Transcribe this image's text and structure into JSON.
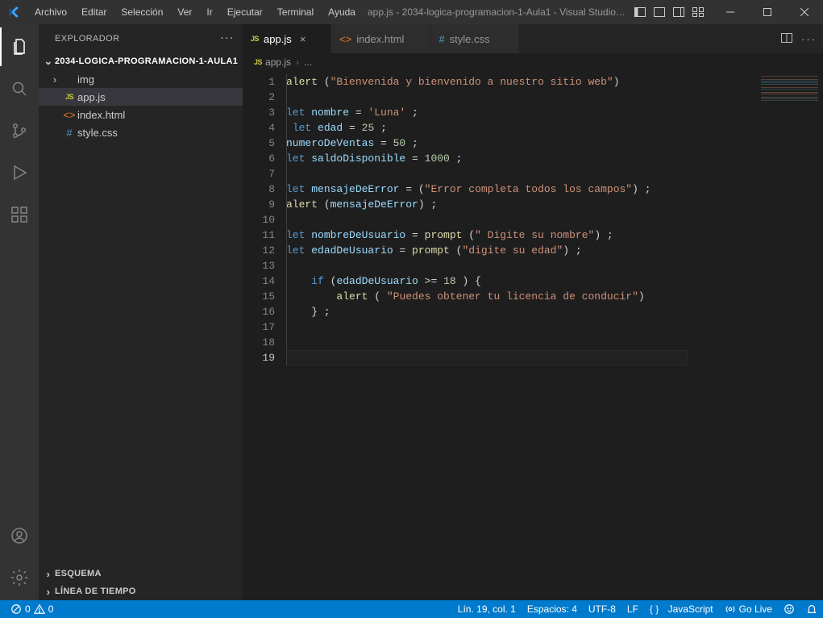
{
  "titlebar": {
    "menus": [
      "Archivo",
      "Editar",
      "Selección",
      "Ver",
      "Ir",
      "Ejecutar",
      "Terminal",
      "Ayuda"
    ],
    "title": "app.js - 2034-logica-programacion-1-Aula1 - Visual Studio ..."
  },
  "sidebar": {
    "header": "EXPLORADOR",
    "root": "2034-LOGICA-PROGRAMACION-1-AULA1",
    "items": [
      {
        "label": "img",
        "type": "folder"
      },
      {
        "label": "app.js",
        "type": "js",
        "selected": true
      },
      {
        "label": "index.html",
        "type": "html"
      },
      {
        "label": "style.css",
        "type": "css"
      }
    ],
    "outline": "ESQUEMA",
    "timeline": "LÍNEA DE TIEMPO"
  },
  "tabs": [
    {
      "label": "app.js",
      "type": "js",
      "active": true
    },
    {
      "label": "index.html",
      "type": "html",
      "active": false
    },
    {
      "label": "style.css",
      "type": "css",
      "active": false
    }
  ],
  "breadcrumb": {
    "file": "app.js",
    "extra": "..."
  },
  "code": {
    "lines": [
      [
        {
          "t": "fn",
          "v": "alert"
        },
        {
          "t": "",
          "v": " ("
        },
        {
          "t": "str",
          "v": "\"Bienvenida y bienvenido a nuestro sitio web\""
        },
        {
          "t": "",
          "v": ")"
        }
      ],
      [],
      [
        {
          "t": "kw",
          "v": "let"
        },
        {
          "t": "",
          "v": " "
        },
        {
          "t": "var",
          "v": "nombre"
        },
        {
          "t": "",
          "v": " = "
        },
        {
          "t": "str",
          "v": "'Luna'"
        },
        {
          "t": "",
          "v": " ;"
        }
      ],
      [
        {
          "t": "",
          "v": " "
        },
        {
          "t": "kw",
          "v": "let"
        },
        {
          "t": "",
          "v": " "
        },
        {
          "t": "var",
          "v": "edad"
        },
        {
          "t": "",
          "v": " = "
        },
        {
          "t": "num",
          "v": "25"
        },
        {
          "t": "",
          "v": " ;"
        }
      ],
      [
        {
          "t": "var",
          "v": "numeroDeVentas"
        },
        {
          "t": "",
          "v": " = "
        },
        {
          "t": "num",
          "v": "50"
        },
        {
          "t": "",
          "v": " ;"
        }
      ],
      [
        {
          "t": "kw",
          "v": "let"
        },
        {
          "t": "",
          "v": " "
        },
        {
          "t": "var",
          "v": "saldoDisponible"
        },
        {
          "t": "",
          "v": " = "
        },
        {
          "t": "num",
          "v": "1000"
        },
        {
          "t": "",
          "v": " ;"
        }
      ],
      [],
      [
        {
          "t": "kw",
          "v": "let"
        },
        {
          "t": "",
          "v": " "
        },
        {
          "t": "var",
          "v": "mensajeDeError"
        },
        {
          "t": "",
          "v": " = ("
        },
        {
          "t": "str",
          "v": "\"Error completa todos los campos\""
        },
        {
          "t": "",
          "v": ") ;"
        }
      ],
      [
        {
          "t": "fn",
          "v": "alert"
        },
        {
          "t": "",
          "v": " ("
        },
        {
          "t": "var",
          "v": "mensajeDeError"
        },
        {
          "t": "",
          "v": ") ;"
        }
      ],
      [],
      [
        {
          "t": "kw",
          "v": "let"
        },
        {
          "t": "",
          "v": " "
        },
        {
          "t": "var",
          "v": "nombreDeUsuario"
        },
        {
          "t": "",
          "v": " = "
        },
        {
          "t": "fn",
          "v": "prompt"
        },
        {
          "t": "",
          "v": " ("
        },
        {
          "t": "str",
          "v": "\" Digite su nombre\""
        },
        {
          "t": "",
          "v": ") ;"
        }
      ],
      [
        {
          "t": "kw",
          "v": "let"
        },
        {
          "t": "",
          "v": " "
        },
        {
          "t": "var",
          "v": "edadDeUsuario"
        },
        {
          "t": "",
          "v": " = "
        },
        {
          "t": "fn",
          "v": "prompt"
        },
        {
          "t": "",
          "v": " ("
        },
        {
          "t": "str",
          "v": "\"digite su edad\""
        },
        {
          "t": "",
          "v": ") ;"
        }
      ],
      [],
      [
        {
          "t": "",
          "v": "    "
        },
        {
          "t": "kw",
          "v": "if"
        },
        {
          "t": "",
          "v": " ("
        },
        {
          "t": "var",
          "v": "edadDeUsuario"
        },
        {
          "t": "",
          "v": " >= "
        },
        {
          "t": "num",
          "v": "18"
        },
        {
          "t": "",
          "v": " ) {"
        }
      ],
      [
        {
          "t": "",
          "v": "        "
        },
        {
          "t": "fn",
          "v": "alert"
        },
        {
          "t": "",
          "v": " ( "
        },
        {
          "t": "str",
          "v": "\"Puedes obtener tu licencia de conducir\""
        },
        {
          "t": "",
          "v": ")"
        }
      ],
      [
        {
          "t": "",
          "v": "    } ;"
        }
      ],
      [],
      [],
      []
    ],
    "currentLine": 19
  },
  "status": {
    "errors": "0",
    "warnings": "0",
    "lncol": "Lín. 19, col. 1",
    "spaces": "Espacios: 4",
    "encoding": "UTF-8",
    "eol": "LF",
    "lang": "JavaScript",
    "golive": "Go Live"
  }
}
